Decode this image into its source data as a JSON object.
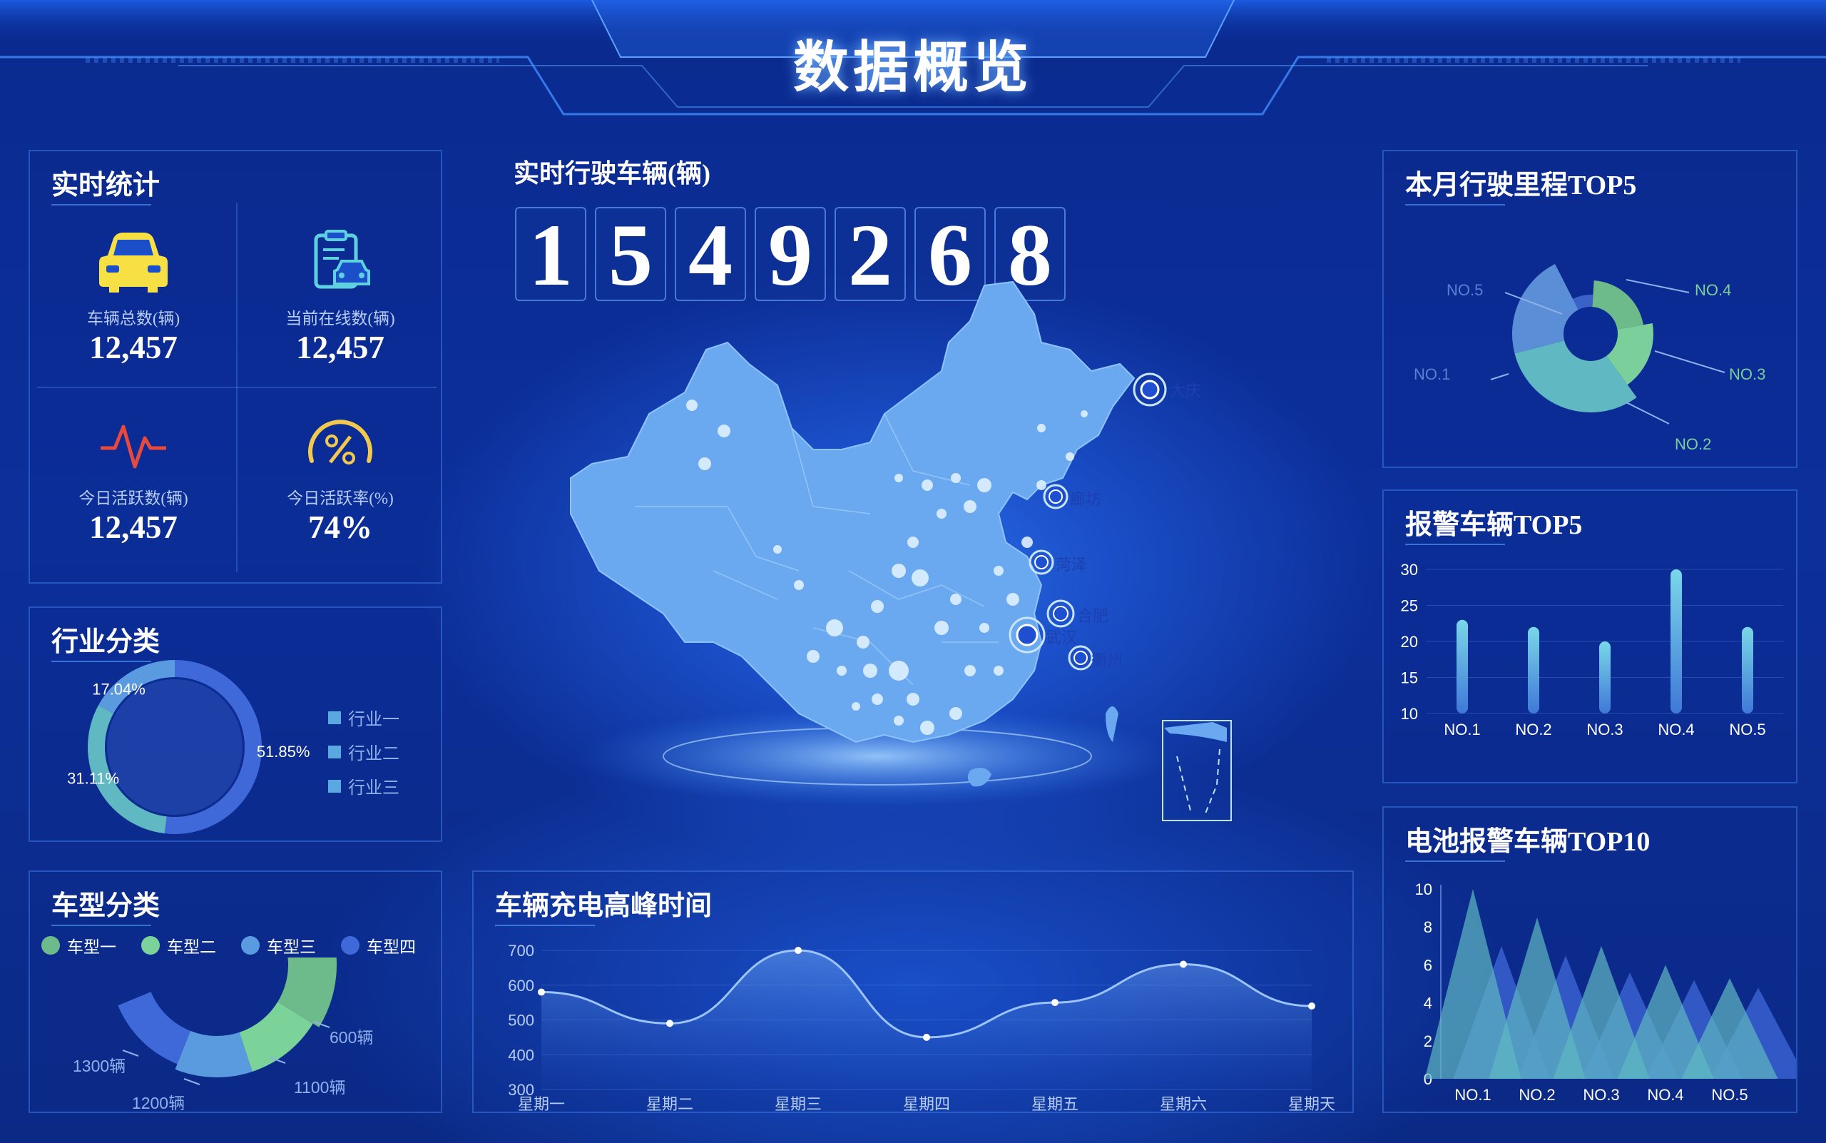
{
  "header": {
    "title": "数据概览"
  },
  "realtime": {
    "title": "实时统计",
    "stats": [
      {
        "label": "车辆总数(辆)",
        "value": "12,457",
        "icon": "car-icon"
      },
      {
        "label": "当前在线数(辆)",
        "value": "12,457",
        "icon": "clipboard-car-icon"
      },
      {
        "label": "今日活跃数(辆)",
        "value": "12,457",
        "icon": "pulse-icon"
      },
      {
        "label": "今日活跃率(%)",
        "value": "74%",
        "icon": "percent-gauge-icon"
      }
    ]
  },
  "driving": {
    "title": "实时行驶车辆(辆)",
    "digits": [
      "1",
      "5",
      "4",
      "9",
      "2",
      "6",
      "8"
    ]
  },
  "map": {
    "cities": [
      "大庆",
      "廊坊",
      "菏泽",
      "合肥",
      "武汉",
      "衢州"
    ]
  },
  "industry": {
    "title": "行业分类",
    "legend": [
      "行业一",
      "行业二",
      "行业三"
    ],
    "chart_data": {
      "type": "pie",
      "categories": [
        "行业一",
        "行业二",
        "行业三"
      ],
      "values": [
        51.85,
        31.11,
        17.04
      ],
      "labels": [
        "51.85%",
        "31.11%",
        "17.04%"
      ]
    }
  },
  "vehicle_type": {
    "title": "车型分类",
    "legend": [
      "车型一",
      "车型二",
      "车型三",
      "车型四"
    ],
    "chart_data": {
      "type": "pie",
      "categories": [
        "车型一",
        "车型二",
        "车型三",
        "车型四"
      ],
      "values": [
        600,
        1100,
        1200,
        1300
      ],
      "labels": [
        "600辆",
        "1100辆",
        "1200辆",
        "1300辆"
      ]
    }
  },
  "charging": {
    "title": "车辆充电高峰时间",
    "chart_data": {
      "type": "area",
      "categories": [
        "星期一",
        "星期二",
        "星期三",
        "星期四",
        "星期五",
        "星期六",
        "星期天"
      ],
      "values": [
        580,
        490,
        700,
        450,
        550,
        660,
        540
      ],
      "ylim": [
        300,
        700
      ],
      "yticks": [
        300,
        400,
        500,
        600,
        700
      ]
    }
  },
  "mileage": {
    "title": "本月行驶里程TOP5",
    "chart_data": {
      "type": "pie",
      "categories": [
        "NO.1",
        "NO.2",
        "NO.3",
        "NO.4",
        "NO.5"
      ],
      "values": [
        90,
        80,
        65,
        55,
        35
      ]
    }
  },
  "alarm": {
    "title": "报警车辆TOP5",
    "chart_data": {
      "type": "bar",
      "categories": [
        "NO.1",
        "NO.2",
        "NO.3",
        "NO.4",
        "NO.5"
      ],
      "values": [
        23,
        22,
        20,
        30,
        22
      ],
      "ylim": [
        10,
        30
      ],
      "yticks": [
        10,
        15,
        20,
        25,
        30
      ]
    }
  },
  "battery": {
    "title": "电池报警车辆TOP10",
    "chart_data": {
      "type": "bar",
      "categories": [
        "NO.1",
        "NO.2",
        "NO.3",
        "NO.4",
        "NO.5"
      ],
      "series": [
        {
          "values": [
            10,
            8.5,
            7,
            6,
            5.3
          ]
        },
        {
          "values": [
            7,
            6.5,
            5.6,
            5.2,
            4.8
          ]
        }
      ],
      "ylim": [
        0,
        10
      ],
      "yticks": [
        0,
        2,
        4,
        6,
        8,
        10
      ]
    }
  },
  "colors": {
    "accent": "#3a7ff0",
    "map": "#6aa9f0",
    "teal": "#5fb8c2",
    "green": "#6dbb8a",
    "blue": "#3f68d8"
  }
}
